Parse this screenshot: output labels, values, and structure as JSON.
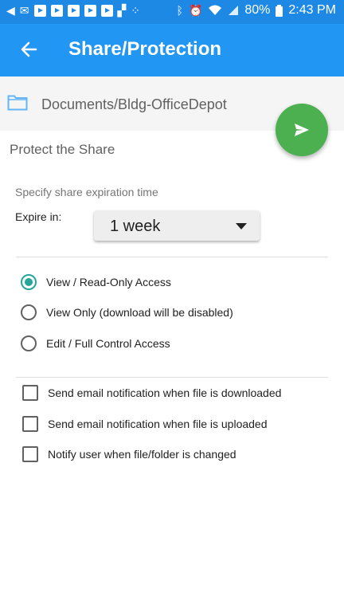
{
  "status_bar": {
    "battery": "80%",
    "time": "2:43 PM",
    "icons": [
      "back-arrow-icon",
      "mail-icon",
      "youtube-icon",
      "youtube-icon",
      "youtube-icon",
      "youtube-icon",
      "youtube-icon",
      "activity-icon",
      "dots-icon",
      "bluetooth-icon",
      "alarm-icon",
      "wifi-icon",
      "signal-icon",
      "battery-icon"
    ]
  },
  "app_bar": {
    "title": "Share/Protection",
    "back_icon": "arrow-left-icon"
  },
  "path_bar": {
    "folder_icon": "folder-icon",
    "path": "Documents/Bldg-OfficeDepot"
  },
  "fab": {
    "icon": "send-icon",
    "color": "#4caf50"
  },
  "protect": {
    "title": "Protect the Share",
    "expiration_label": "Specify share expiration time",
    "expire_in_label": "Expire in:",
    "expire_value": "1 week"
  },
  "access": {
    "options": [
      {
        "label": "View / Read-Only Access",
        "selected": true
      },
      {
        "label": "View Only (download will be disabled)",
        "selected": false
      },
      {
        "label": "Edit / Full Control Access",
        "selected": false
      }
    ]
  },
  "notifications": {
    "options": [
      {
        "label": "Send email notification when file is downloaded",
        "checked": false
      },
      {
        "label": "Send email notification when file is uploaded",
        "checked": false
      },
      {
        "label": "Notify user when file/folder is changed",
        "checked": false
      }
    ]
  },
  "colors": {
    "appbar": "#2196f3",
    "statusbar": "#1e88e5",
    "accent": "#26a69a",
    "fab": "#4caf50"
  }
}
